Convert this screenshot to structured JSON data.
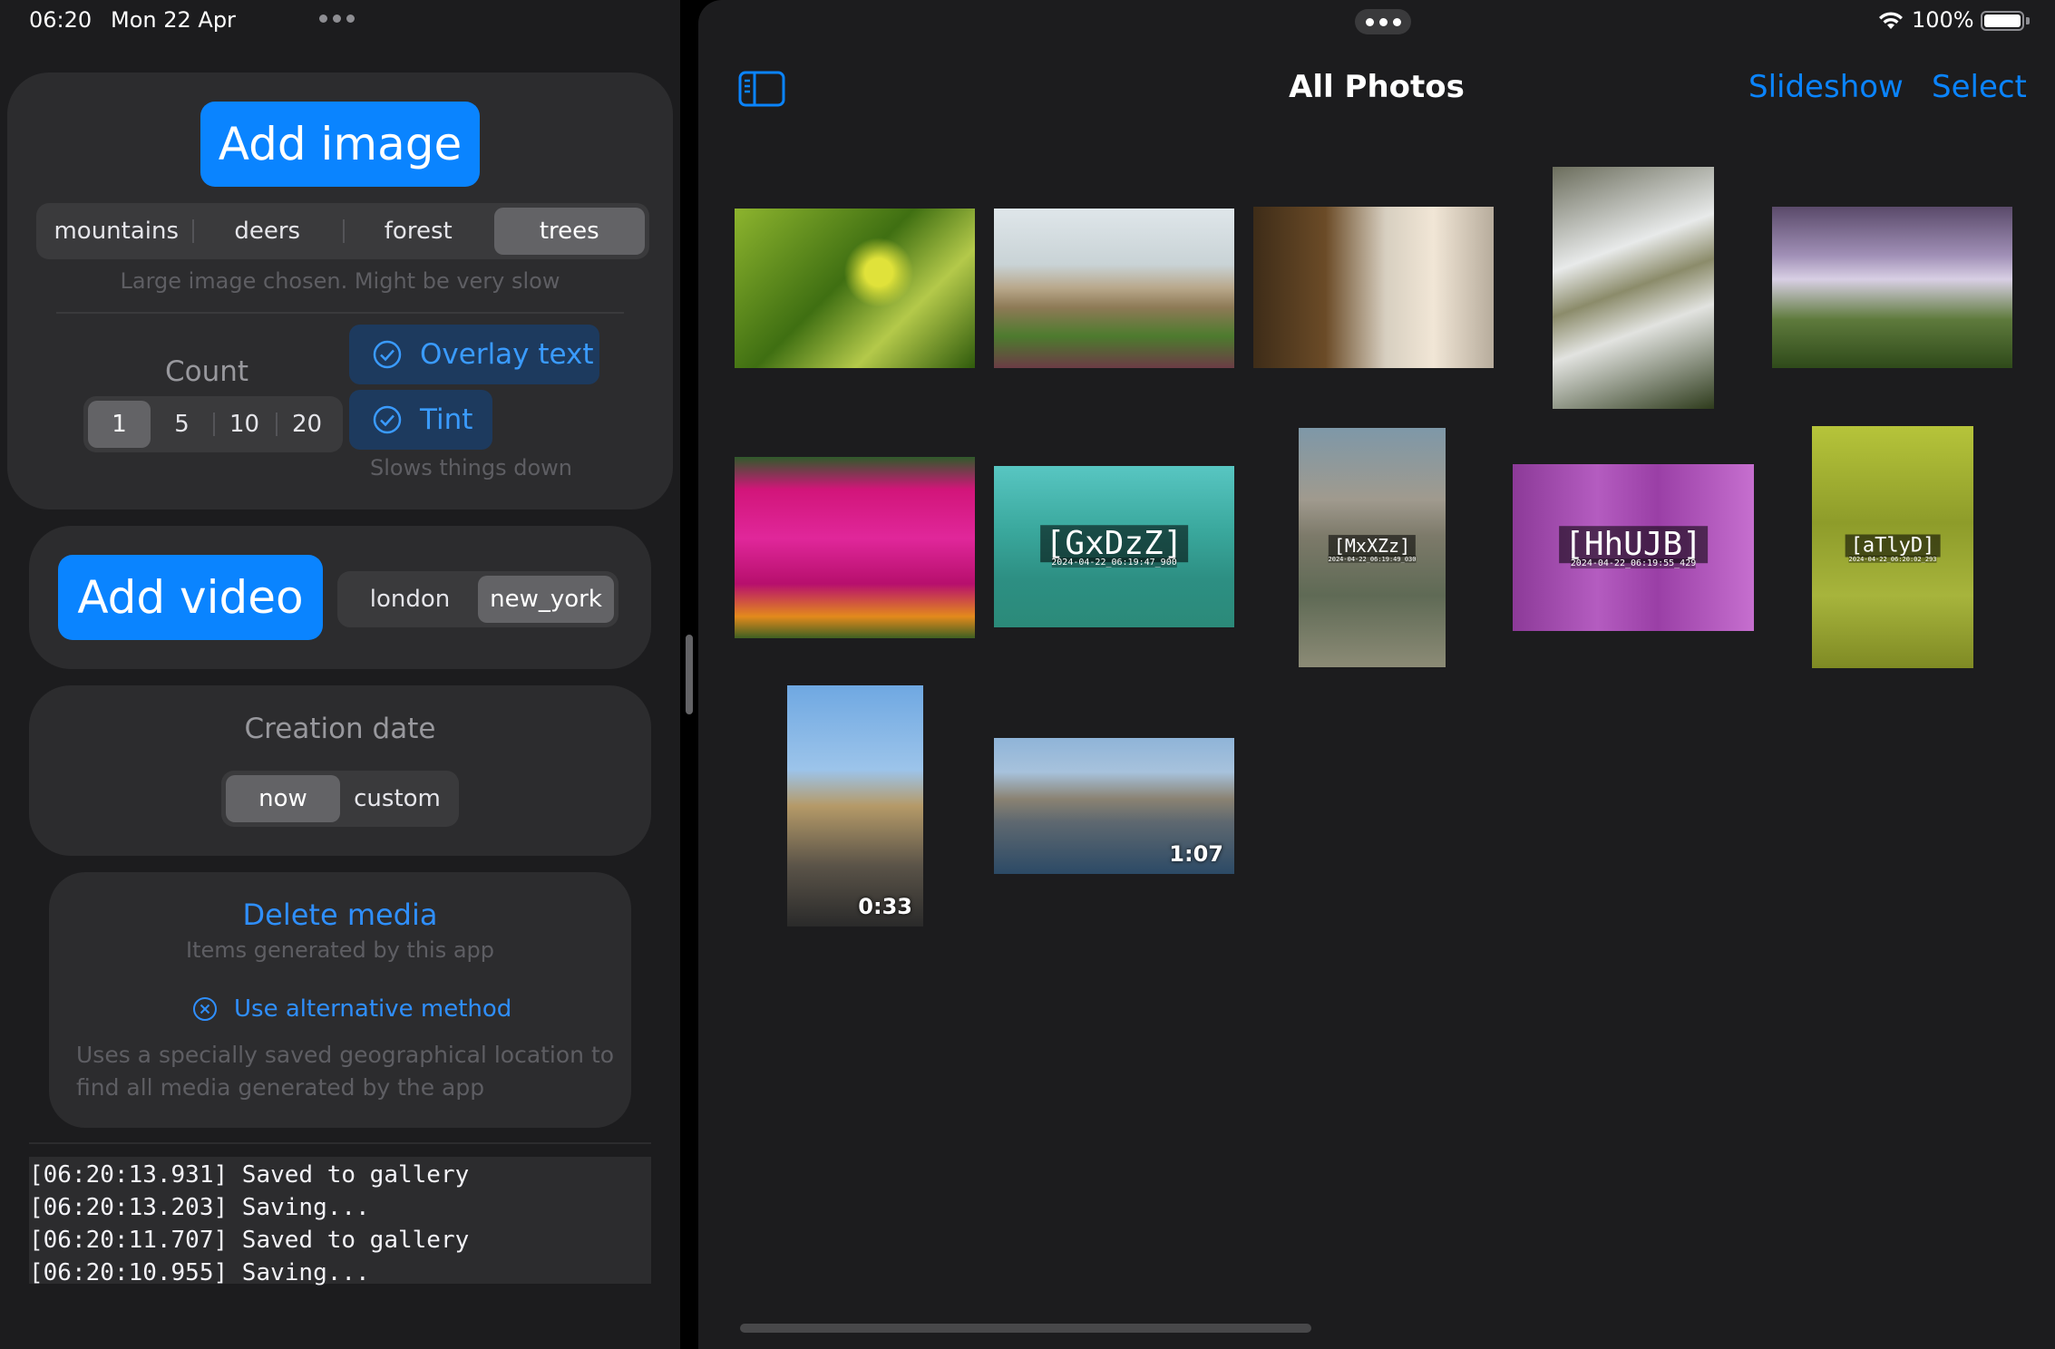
{
  "status_bar": {
    "time": "06:20",
    "date": "Mon 22 Apr",
    "battery": "100%"
  },
  "left": {
    "add_image": "Add image",
    "image_options": [
      "mountains",
      "deers",
      "forest",
      "trees"
    ],
    "image_selected": "trees",
    "image_warning": "Large image chosen. Might be very slow",
    "count_label": "Count",
    "count_options": [
      "1",
      "5",
      "10",
      "20"
    ],
    "count_selected": "1",
    "overlay_text": "Overlay text",
    "tint": "Tint",
    "slows_note": "Slows things down",
    "add_video": "Add video",
    "video_options": [
      "london",
      "new_york"
    ],
    "video_selected": "new_york",
    "creation_date_label": "Creation date",
    "date_options": [
      "now",
      "custom"
    ],
    "date_selected": "now",
    "delete_media": "Delete media",
    "delete_sub": "Items generated by this app",
    "alt_method": "Use alternative method",
    "alt_desc_1": "Uses a specially saved geographical location to",
    "alt_desc_2": "find all media generated by the app",
    "log": [
      "[06:20:13.931] Saved to gallery",
      "[06:20:13.203] Saving...",
      "[06:20:11.707] Saved to gallery",
      "[06:20:10.955] Saving..."
    ]
  },
  "right": {
    "title": "All Photos",
    "slideshow": "Slideshow",
    "select": "Select",
    "photos": [
      {
        "name": "leaves"
      },
      {
        "name": "dune-grass"
      },
      {
        "name": "waterfall-cliff"
      },
      {
        "name": "waterfall-rocks"
      },
      {
        "name": "waterfall-valley"
      },
      {
        "name": "flowers"
      },
      {
        "name": "valley-tinted",
        "caption": "[GxDzZ]",
        "timestamp": "2024-04-22_06:19:47_900"
      },
      {
        "name": "half-dome",
        "caption": "[MxXZz]",
        "timestamp": "2024-04-22_06:19:49_030"
      },
      {
        "name": "forest-tinted",
        "caption": "[HhUJB]",
        "timestamp": "2024-04-22_06:19:55_429"
      },
      {
        "name": "trees-tinted",
        "caption": "[aTlyD]",
        "timestamp": "2024-04-22_06:20:02_293"
      },
      {
        "name": "big-ben-video",
        "duration": "0:33"
      },
      {
        "name": "new-york-video",
        "duration": "1:07"
      }
    ]
  },
  "colors": {
    "accent": "#0a84ff",
    "background": "#1c1c1e",
    "card": "#2c2c2e"
  }
}
